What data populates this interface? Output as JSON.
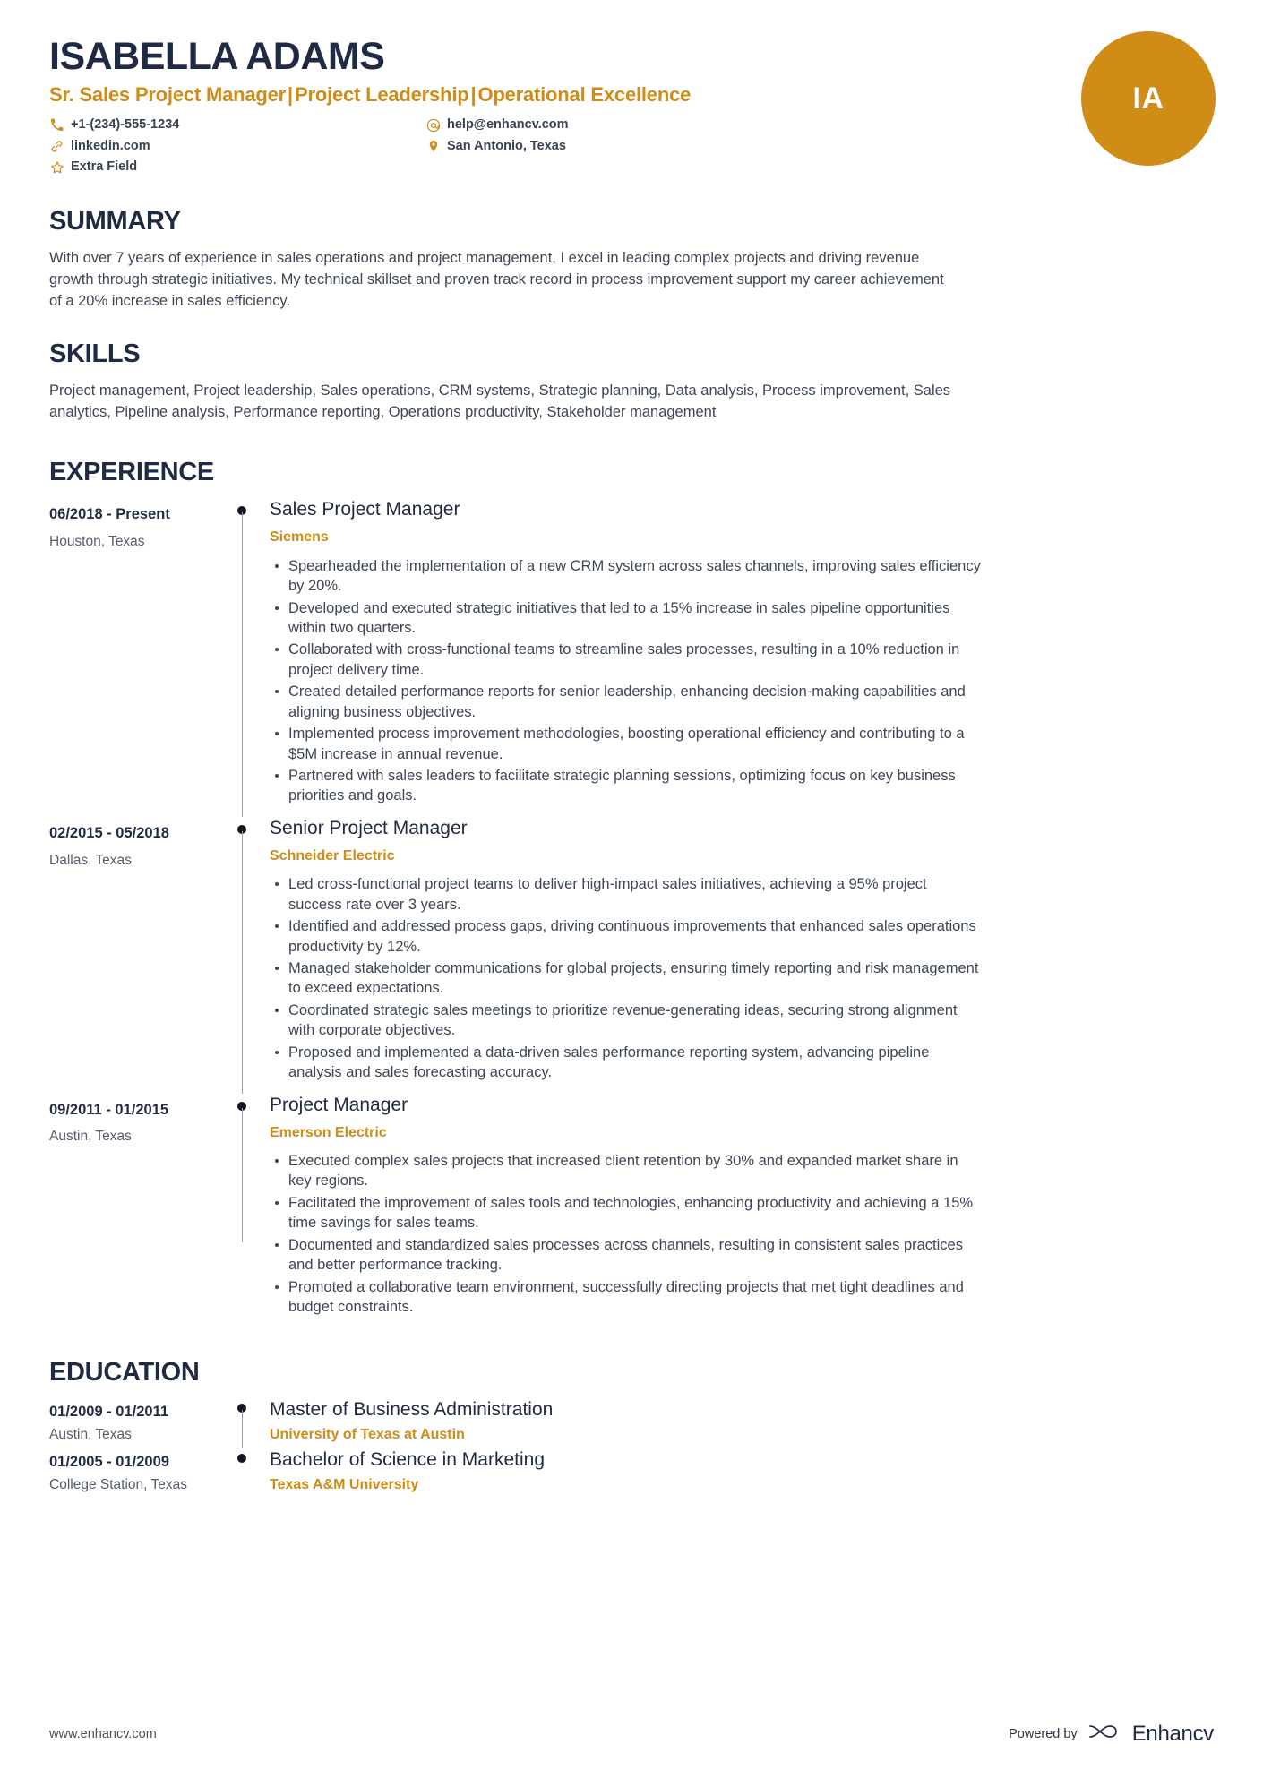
{
  "theme": {
    "accent": "#cf8c17",
    "dark": "#1f2b42",
    "body_text": "#3d4655",
    "muted": "#555e6b"
  },
  "header": {
    "name": "ISABELLA ADAMS",
    "subtitle_parts": [
      "Sr. Sales Project Manager",
      "Project Leadership",
      "Operational Excellence"
    ],
    "subtitle_separator": "|",
    "monogram": "IA",
    "contacts": [
      {
        "icon": "phone-icon",
        "label": "+1-(234)-555-1234",
        "column": "left"
      },
      {
        "icon": "email-icon",
        "label": "help@enhancv.com",
        "column": "right"
      },
      {
        "icon": "link-icon",
        "label": "linkedin.com",
        "column": "left"
      },
      {
        "icon": "location-pin-icon",
        "label": "San Antonio, Texas",
        "column": "right"
      },
      {
        "icon": "star-icon",
        "label": "Extra Field",
        "column": "left"
      }
    ]
  },
  "summary": {
    "title": "SUMMARY",
    "text": "With over 7 years of experience in sales operations and project management, I excel in leading complex projects and driving revenue growth through strategic initiatives. My technical skillset and proven track record in process improvement support my career achievement of a 20% increase in sales efficiency."
  },
  "skills": {
    "title": "SKILLS",
    "text": "Project management, Project leadership, Sales operations, CRM systems, Strategic planning, Data analysis, Process improvement, Sales analytics, Pipeline analysis, Performance reporting, Operations productivity, Stakeholder management"
  },
  "experience": {
    "title": "EXPERIENCE",
    "entries": [
      {
        "date": "06/2018 - Present",
        "location": "Houston, Texas",
        "title": "Sales Project Manager",
        "organization": "Siemens",
        "bullets": [
          "Spearheaded the implementation of a new CRM system across sales channels, improving sales efficiency by 20%.",
          "Developed and executed strategic initiatives that led to a 15% increase in sales pipeline opportunities within two quarters.",
          "Collaborated with cross-functional teams to streamline sales processes, resulting in a 10% reduction in project delivery time.",
          "Created detailed performance reports for senior leadership, enhancing decision-making capabilities and aligning business objectives.",
          "Implemented process improvement methodologies, boosting operational efficiency and contributing to a $5M increase in annual revenue.",
          "Partnered with sales leaders to facilitate strategic planning sessions, optimizing focus on key business priorities and goals."
        ]
      },
      {
        "date": "02/2015 - 05/2018",
        "location": "Dallas, Texas",
        "title": "Senior Project Manager",
        "organization": "Schneider Electric",
        "bullets": [
          "Led cross-functional project teams to deliver high-impact sales initiatives, achieving a 95% project success rate over 3 years.",
          "Identified and addressed process gaps, driving continuous improvements that enhanced sales operations productivity by 12%.",
          "Managed stakeholder communications for global projects, ensuring timely reporting and risk management to exceed expectations.",
          "Coordinated strategic sales meetings to prioritize revenue-generating ideas, securing strong alignment with corporate objectives.",
          "Proposed and implemented a data-driven sales performance reporting system, advancing pipeline analysis and sales forecasting accuracy."
        ]
      },
      {
        "date": "09/2011 - 01/2015",
        "location": "Austin, Texas",
        "title": "Project Manager",
        "organization": "Emerson Electric",
        "bullets": [
          "Executed complex sales projects that increased client retention by 30% and expanded market share in key regions.",
          "Facilitated the improvement of sales tools and technologies, enhancing productivity and achieving a 15% time savings for sales teams.",
          "Documented and standardized sales processes across channels, resulting in consistent sales practices and better performance tracking.",
          "Promoted a collaborative team environment, successfully directing projects that met tight deadlines and budget constraints."
        ]
      }
    ]
  },
  "education": {
    "title": "EDUCATION",
    "entries": [
      {
        "date": "01/2009 - 01/2011",
        "location": "Austin, Texas",
        "title": "Master of Business Administration",
        "organization": "University of Texas at Austin"
      },
      {
        "date": "01/2005 - 01/2009",
        "location": "College Station, Texas",
        "title": "Bachelor of Science in Marketing",
        "organization": "Texas A&M University"
      }
    ]
  },
  "footer": {
    "url": "www.enhancv.com",
    "powered_by": "Powered by",
    "brand_name": "Enhancv",
    "brand_logo": "enhancv-logo-icon"
  }
}
